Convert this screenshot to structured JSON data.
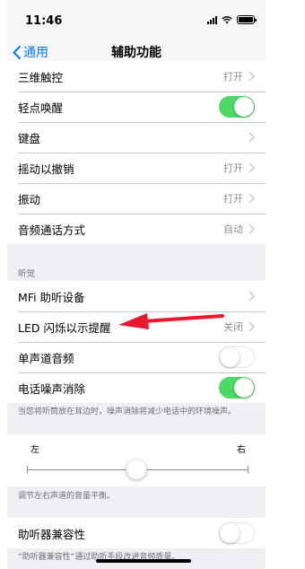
{
  "status": {
    "time": "11:46"
  },
  "nav": {
    "back_label": "通用",
    "title": "辅助功能"
  },
  "group1": {
    "rows": [
      {
        "label": "三维触控",
        "value": "打开"
      },
      {
        "label": "轻点唤醒",
        "toggle": "on"
      },
      {
        "label": "键盘",
        "value": ""
      },
      {
        "label": "摇动以撤销",
        "value": "打开"
      },
      {
        "label": "振动",
        "value": "打开"
      },
      {
        "label": "音频通话方式",
        "value": "自动"
      }
    ]
  },
  "hearing": {
    "header": "听觉",
    "rows": [
      {
        "label": "MFi 助听设备",
        "value": ""
      },
      {
        "label": "LED 闪烁以示提醒",
        "value": "关闭"
      },
      {
        "label": "单声道音频",
        "toggle": "off"
      },
      {
        "label": "电话噪声消除",
        "toggle": "on"
      }
    ],
    "note": "当您将听筒放在耳边时，噪声消除将减少电话中的环境噪声。"
  },
  "balance": {
    "left_label": "左",
    "right_label": "右",
    "value": 0.5,
    "note": "调节左右声道的音量平衡。"
  },
  "hearing_aid": {
    "label": "助听器兼容性",
    "toggle": "off",
    "note": "“助听器兼容性”通过助听手段改进音频质量。"
  },
  "colors": {
    "accent": "#007aff",
    "switch_on": "#4cd964",
    "annotation_arrow": "#e8192c"
  }
}
